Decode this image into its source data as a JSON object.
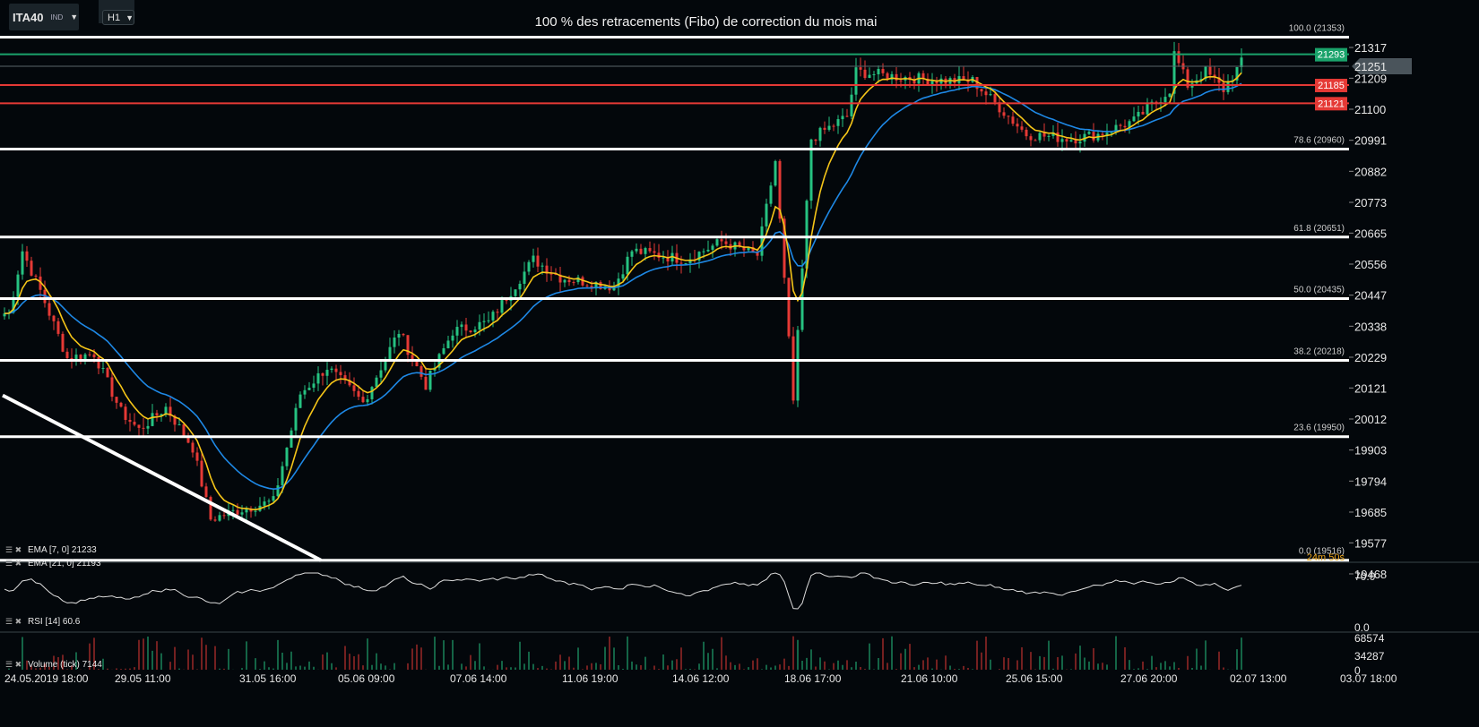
{
  "header": {
    "symbol": "ITA40",
    "symbol_type": "IND",
    "timeframe": "H1",
    "title": "100 % des retracements (Fibo) de correction du mois mai"
  },
  "indicators": {
    "ema7": "EMA [7, 0] 21233",
    "ema21": "EMA [21, 0] 21193",
    "rsi": "RSI [14] 60.6",
    "volume": "Volume (tick) 7144"
  },
  "countdown": "24m 50s",
  "colors": {
    "up": "#26c281",
    "down": "#e53935",
    "ema7": "#f5c518",
    "ema21": "#1e88e5",
    "fib": "#ffffff",
    "green_level": "#1aa36b",
    "red_level": "#e53935"
  },
  "chart_data": {
    "type": "candlestick",
    "price_axis": {
      "ticks": [
        21317,
        21209,
        21100,
        20991,
        20882,
        20773,
        20665,
        20556,
        20447,
        20338,
        20229,
        20121,
        20012,
        19903,
        19794,
        19685,
        19577,
        19468
      ],
      "range": [
        19468,
        21353
      ]
    },
    "current_price": 21251,
    "time_labels": [
      "24.05.2019  18:00",
      "29.05  11:00",
      "31.05  16:00",
      "05.06  09:00",
      "07.06  14:00",
      "11.06  19:00",
      "14.06  12:00",
      "18.06  17:00",
      "21.06  10:00",
      "25.06  15:00",
      "27.06  20:00",
      "02.07  13:00",
      "03.07  18:00"
    ],
    "fib_levels": [
      {
        "label": "100.0 (21353)",
        "price": 21353
      },
      {
        "label": "78.6 (20960)",
        "price": 20960
      },
      {
        "label": "61.8 (20651)",
        "price": 20651
      },
      {
        "label": "50.0 (20435)",
        "price": 20435
      },
      {
        "label": "38.2 (20218)",
        "price": 20218
      },
      {
        "label": "23.6 (19950)",
        "price": 19950
      },
      {
        "label": "0.0 (19516)",
        "price": 19516
      }
    ],
    "horizontal_levels": [
      {
        "label": "21293",
        "price": 21293,
        "color": "green"
      },
      {
        "label": "21185",
        "price": 21185,
        "color": "red"
      },
      {
        "label": "21121",
        "price": 21121,
        "color": "red"
      }
    ],
    "trendline": {
      "from_price": 20095,
      "to_price": 19516,
      "from_bar": 0,
      "to_bar": 71
    },
    "close_keypoints": [
      [
        1,
        20383
      ],
      [
        4,
        20603
      ],
      [
        8,
        20462
      ],
      [
        14,
        20226
      ],
      [
        20,
        20242
      ],
      [
        26,
        20037
      ],
      [
        30,
        19974
      ],
      [
        36,
        20053
      ],
      [
        42,
        19911
      ],
      [
        46,
        19660
      ],
      [
        52,
        19691
      ],
      [
        60,
        19723
      ],
      [
        66,
        20100
      ],
      [
        72,
        20194
      ],
      [
        80,
        20069
      ],
      [
        88,
        20320
      ],
      [
        94,
        20131
      ],
      [
        100,
        20320
      ],
      [
        108,
        20352
      ],
      [
        118,
        20572
      ],
      [
        124,
        20509
      ],
      [
        136,
        20477
      ],
      [
        140,
        20603
      ],
      [
        152,
        20572
      ],
      [
        160,
        20635
      ],
      [
        168,
        20587
      ],
      [
        172,
        20918
      ],
      [
        176,
        20075
      ],
      [
        176,
        21075
      ],
      [
        180,
        20996
      ],
      [
        188,
        21075
      ],
      [
        190,
        21232
      ],
      [
        198,
        21216
      ],
      [
        210,
        21200
      ],
      [
        216,
        21200
      ],
      [
        222,
        21106
      ],
      [
        228,
        21012
      ],
      [
        238,
        20996
      ],
      [
        244,
        21012
      ],
      [
        252,
        21059
      ],
      [
        260,
        21169
      ],
      [
        261,
        21295
      ],
      [
        264,
        21185
      ],
      [
        268,
        21232
      ],
      [
        272,
        21169
      ],
      [
        276,
        21263
      ]
    ],
    "rsi": {
      "ticks": [
        70.0,
        0.0
      ],
      "last": 60.6
    },
    "volume": {
      "ticks": [
        68574,
        34287,
        0
      ],
      "last": 7144
    }
  }
}
